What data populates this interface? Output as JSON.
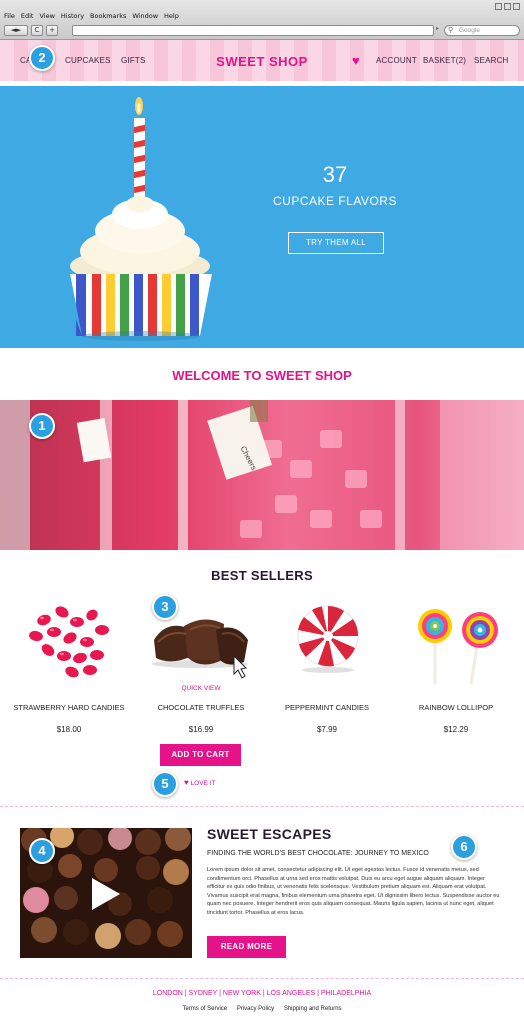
{
  "browser": {
    "menu": [
      "File",
      "Edit",
      "View",
      "History",
      "Bookmarks",
      "Window",
      "Help"
    ],
    "nav_buttons": [
      "◄",
      "►",
      "C",
      "+"
    ],
    "search_placeholder": "Google"
  },
  "site_nav": {
    "left_links": [
      "CA",
      "CUPCAKES",
      "GIFTS"
    ],
    "logo": "SWEET SHOP",
    "right_links": [
      "ACCOUNT",
      "BASKET(2)",
      "SEARCH"
    ]
  },
  "hero": {
    "count": "37",
    "subtitle": "CUPCAKE FLAVORS",
    "button": "TRY THEM ALL"
  },
  "welcome": "WELCOME TO  SWEET SHOP",
  "best_sellers": {
    "title": "BEST SELLERS",
    "products": [
      {
        "name": "STRAWBERRY HARD CANDIES",
        "price": "$18.00"
      },
      {
        "name": "CHOCOLATE TRUFFLES",
        "price": "$16.99"
      },
      {
        "name": "PEPPERMINT CANDIES",
        "price": "$7.99"
      },
      {
        "name": "RAINBOW LOLLIPOP",
        "price": "$12.29"
      }
    ],
    "quick_view": "QUICK VIEW",
    "add_to_cart": "ADD TO CART",
    "love_it": "LOVE IT"
  },
  "blog": {
    "title": "SWEET ESCAPES",
    "subtitle": "FINDING THE WORLD'S BEST CHOCOLATE: JOURNEY TO MEXICO",
    "body": "Lorem ipsum dolor sit amet, consectetur adipiscing elit. Ut eget egestas lectus. Fusce id venenatis metus, sed condimentum orci. Phasellus at urna sed eros mattis volutpat. Duis eu arcu eget augue aliquam aliquam. Integer efficitur ex quis odio finibus, ut venenatis felis scelerisque. Vestibulum pretium aliquam est. Aliquam erat volutpat. Vivamus suscipit erat magna, finibus elementum urna pharetra eget. Ut dignissim libero lectus. Suspendisse auctor eu quam nec posuere. Integer hendrerit eros quis aliquam consequat. Mauris ligula sapien, lacinia ut nunc eget, aliquet tincidunt tortor. Phasellus at eros lacus.",
    "read_more": "READ MORE"
  },
  "footer": {
    "cities": "LONDON  |  SYDNEY  |  NEW YORK  |  LOS ANGELES  |  PHILADELPHIA",
    "links": [
      "Terms of Service",
      "Privacy Policy",
      "Shipping and Returns"
    ]
  },
  "markers": [
    "1",
    "2",
    "3",
    "4",
    "5",
    "6"
  ],
  "colors": {
    "brand_pink": "#e5128a",
    "hero_blue": "#3fa9e4",
    "marker_blue": "#2b9fe0",
    "nav_pink": "#fbd6e4"
  }
}
